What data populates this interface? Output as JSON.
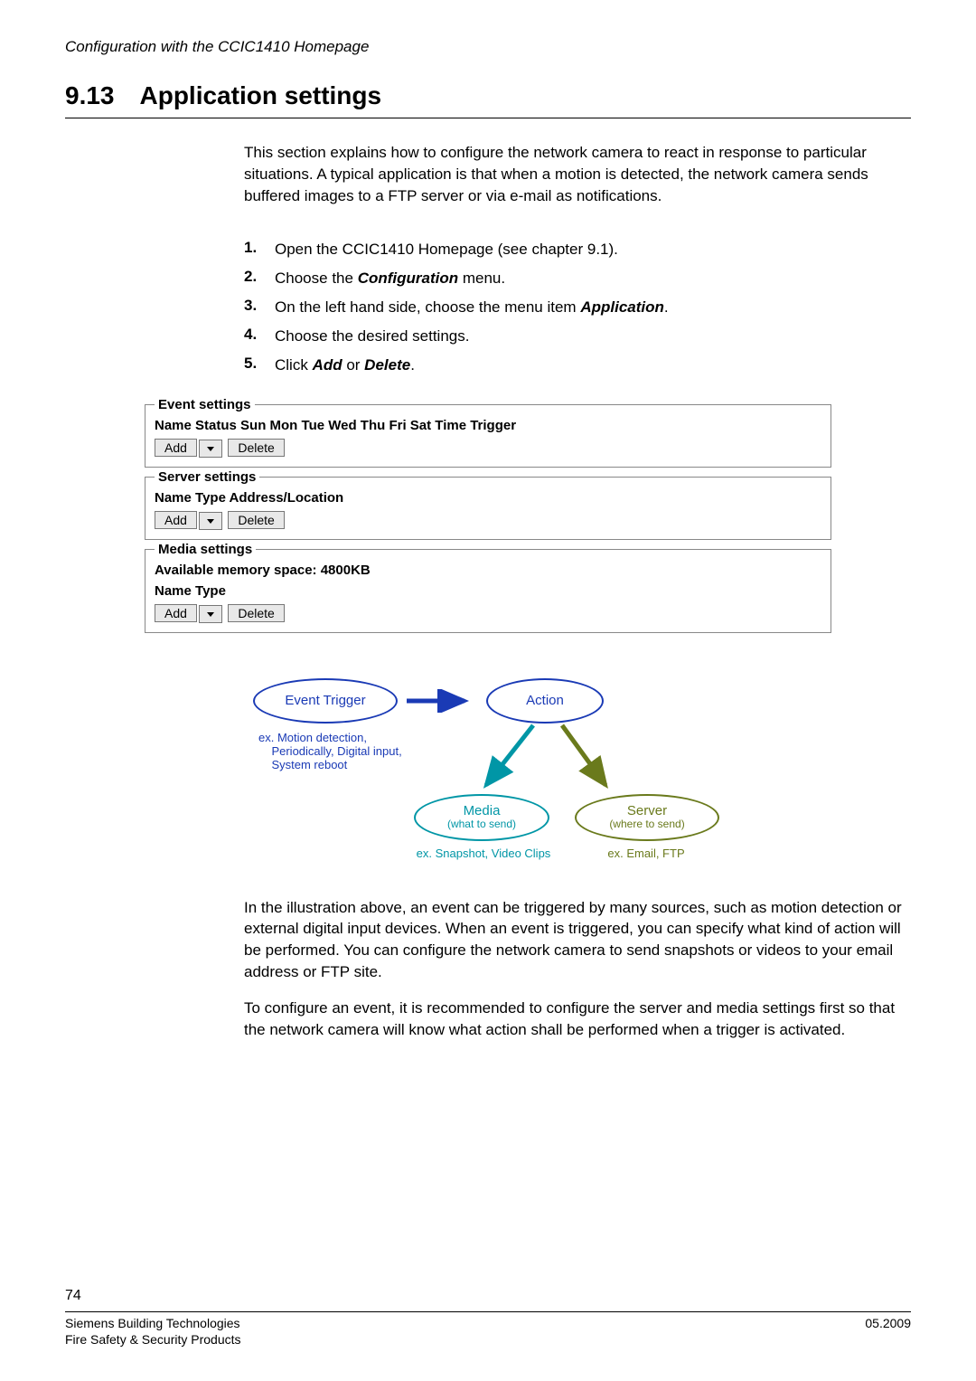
{
  "header": {
    "doc_title": "Configuration with the CCIC1410 Homepage"
  },
  "section": {
    "number": "9.13",
    "title": "Application settings"
  },
  "intro": "This section explains how to configure the network camera to react in response to particular situations. A typical application is that when a motion is detected, the network camera sends buffered images to a FTP server or via e-mail as notifications.",
  "steps": [
    {
      "num": "1.",
      "pre": "Open the CCIC1410 Homepage (see chapter 9.1)."
    },
    {
      "num": "2.",
      "pre": "Choose the ",
      "b1": "Configuration",
      "post": " menu."
    },
    {
      "num": "3.",
      "pre": "On the left hand side, choose the menu item ",
      "b1": "Application",
      "post": "."
    },
    {
      "num": "4.",
      "pre": "Choose the desired settings."
    },
    {
      "num": "5.",
      "pre": "Click ",
      "b1": "Add",
      "mid": " or ",
      "b2": "Delete",
      "post": "."
    }
  ],
  "event_settings": {
    "legend": "Event settings",
    "header": "Name Status Sun Mon Tue Wed Thu Fri Sat Time Trigger",
    "add": "Add",
    "delete": "Delete"
  },
  "server_settings": {
    "legend": "Server settings",
    "header": "Name Type Address/Location",
    "add": "Add",
    "delete": "Delete"
  },
  "media_settings": {
    "legend": "Media settings",
    "memory": "Available memory space: 4800KB",
    "header": "Name Type",
    "add": "Add",
    "delete": "Delete"
  },
  "diagram": {
    "event_trigger": "Event Trigger",
    "event_examples": "ex. Motion detection,\n    Periodically, Digital input,\n    System reboot",
    "action": "Action",
    "media": "Media",
    "media_sub": "(what to send)",
    "media_ex": "ex. Snapshot, Video Clips",
    "server": "Server",
    "server_sub": "(where to send)",
    "server_ex": "ex. Email, FTP"
  },
  "post_paras": {
    "p1": "In the illustration above, an event can be triggered by many sources, such as motion detection or external digital input devices. When an event is triggered, you can specify what kind of action will be performed. You can configure the network camera to send snapshots or videos to your email address or FTP site.",
    "p2": "To configure an event, it is recommended to configure the server and media settings first so that the network camera will know what action shall be performed when a trigger is activated."
  },
  "footer": {
    "page": "74",
    "line1": "Siemens Building Technologies",
    "line2": "Fire Safety & Security Products",
    "date": "05.2009"
  }
}
